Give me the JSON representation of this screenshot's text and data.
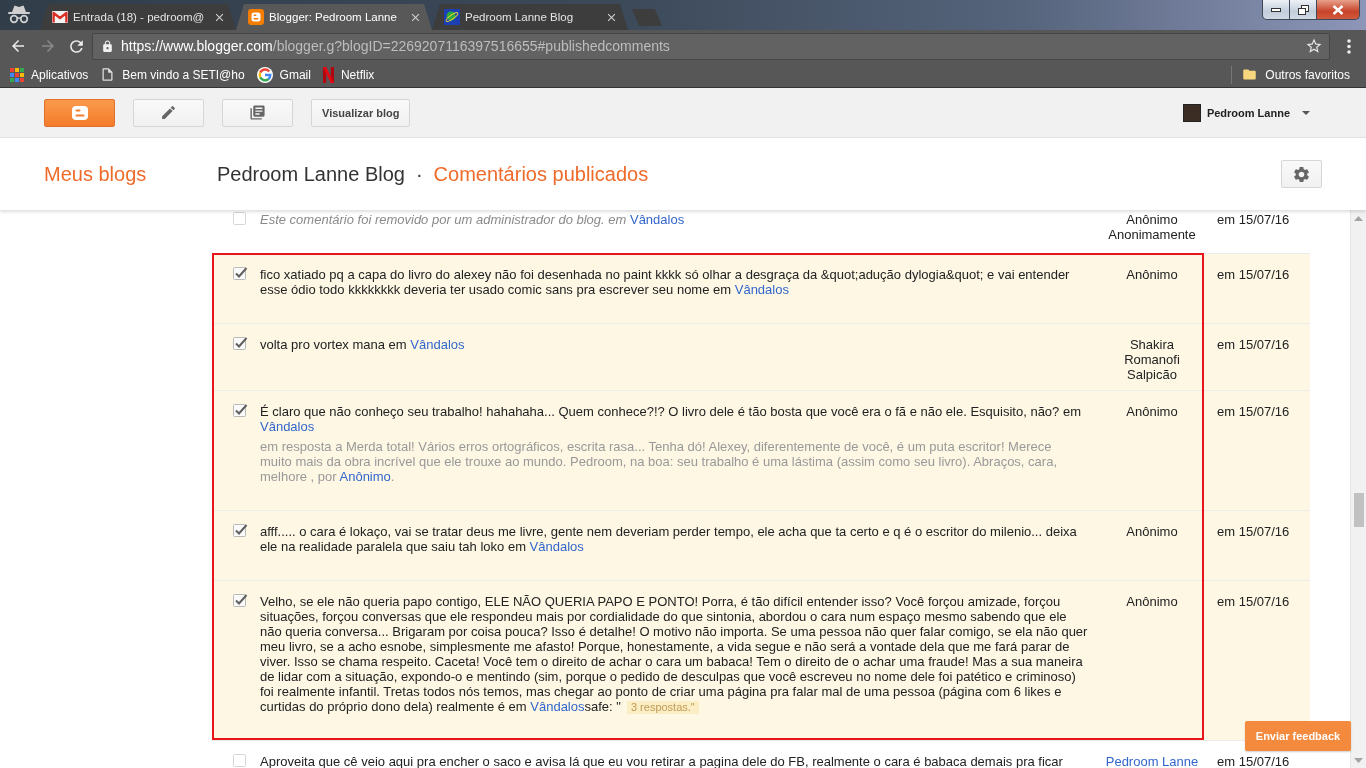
{
  "browser": {
    "tabs": [
      {
        "kind": "gmail",
        "title": "Entrada (18) - pedroom@",
        "selected": false
      },
      {
        "kind": "blogger",
        "title": "Blogger: Pedroom Lanne",
        "selected": true
      },
      {
        "kind": "blog",
        "title": "Pedroom Lanne Blog",
        "selected": false
      }
    ],
    "address": {
      "host": "https://www.blogger.com",
      "path": "/blogger.g?blogID=2269207116397516655#publishedcomments"
    },
    "bookmarks": [
      {
        "kind": "apps",
        "label": "Aplicativos"
      },
      {
        "kind": "page",
        "label": "Bem vindo a SETI@ho"
      },
      {
        "kind": "google",
        "label": "Gmail"
      },
      {
        "kind": "netflix",
        "label": "Netflix"
      }
    ],
    "other_bookmarks": {
      "label": "Outros favoritos"
    }
  },
  "blogger_bar": {
    "view_blog_button": "Visualizar blog",
    "account_name": "Pedroom Lanne"
  },
  "header": {
    "my_blogs_link": "Meus blogs",
    "blog_title": "Pedroom Lanne Blog",
    "separator": "·",
    "section_title": "Comentários publicados"
  },
  "comments": [
    {
      "checked": false,
      "outlined": false,
      "removed": true,
      "text": "Este comentário foi removido por um administrador do blog. em",
      "post_link": "Vândalos",
      "author": "Anônimo Anonimamente",
      "author_linked": false,
      "date": "em 15/07/16"
    },
    {
      "checked": true,
      "outlined": true,
      "removed": false,
      "text": "fico xatiado pq a capa do livro do alexey não foi desenhada no paint kkkk só olhar a desgraça da &quot;adução dylogia&quot; e vai entender esse ódio todo kkkkkkkk deveria ter usado comic sans pra escrever seu nome em",
      "post_link": "Vândalos",
      "author": "Anônimo",
      "author_linked": false,
      "date": "em 15/07/16"
    },
    {
      "checked": true,
      "outlined": true,
      "removed": false,
      "text": "volta pro vortex mana em",
      "post_link": "Vândalos",
      "author": "Shakira Romanofi Salpicão",
      "author_linked": false,
      "date": "em 15/07/16"
    },
    {
      "checked": true,
      "outlined": true,
      "removed": false,
      "text": "É claro que não conheço seu trabalho! hahahaha... Quem conhece?!? O livro dele é tão bosta que você era o fã e não ele. Esquisito, não? em",
      "post_link": "Vândalos",
      "reply": {
        "text": "em resposta a Merda total! Vários erros ortográficos, escrita rasa... Tenha dó! Alexey, diferentemente de você, é um puta escritor! Merece muito mais da obra incrível que ele trouxe ao mundo. Pedroom, na boa: seu trabalho é uma lástima (assim como seu livro). Abraços, cara, melhore , por",
        "author_link": "Anônimo",
        "after": "."
      },
      "author": "Anônimo",
      "author_linked": false,
      "date": "em 15/07/16"
    },
    {
      "checked": true,
      "outlined": true,
      "removed": false,
      "text": "afff..... o cara é lokaço, vai se tratar deus me livre, gente nem deveriam perder tempo, ele acha que ta certo e q é o escritor do milenio... deixa ele na realidade paralela que saiu tah loko em",
      "post_link": "Vândalos",
      "author": "Anônimo",
      "author_linked": false,
      "date": "em 15/07/16"
    },
    {
      "checked": true,
      "outlined": true,
      "removed": false,
      "text": "Velho, se ele não queria papo contigo, ELE NÃO QUERIA PAPO E PONTO! Porra, é tão difícil entender isso? Você forçou amizade, forçou situações, forçou conversas que ele respondeu mais por cordialidade do que sintonia, abordou o cara num espaço mesmo sabendo que ele não queria conversa... Brigaram por coisa pouca? Isso é detalhe! O motivo não importa. Se uma pessoa não quer falar comigo, se ela não quer meu livro, se a acho esnobe, simplesmente me afasto! Porque, honestamente, a vida segue e não será a vontade dela que me fará parar de viver. Isso se chama respeito. Caceta! Você tem o direito de achar o cara um babaca! Tem o direito de o achar uma fraude! Mas a sua maneira de lidar com a situação, expondo-o e mentindo (sim, porque o pedido de desculpas que você escreveu no nome dele foi patético e criminoso) foi realmente infantil. Tretas todos nós temos, mas chegar ao ponto de criar uma página pra falar mal de uma pessoa (página com 6 likes e curtidas do próprio dono dela) realmente é em",
      "post_link": "Vândalos",
      "text_after": "safe: \"",
      "badge": "3 respostas.\"",
      "author": "Anônimo",
      "author_linked": false,
      "date": "em 15/07/16"
    },
    {
      "checked": false,
      "outlined": false,
      "removed": false,
      "text": "Aproveita que cê veio aqui pra encher o saco e avisa lá que eu vou retirar a pagina dele do FB, realmente o cara é babaca demais pra ficar",
      "author": "Pedroom Lanne",
      "author_linked": true,
      "date": "em 15/07/16"
    }
  ],
  "feedback_button": "Enviar feedback"
}
